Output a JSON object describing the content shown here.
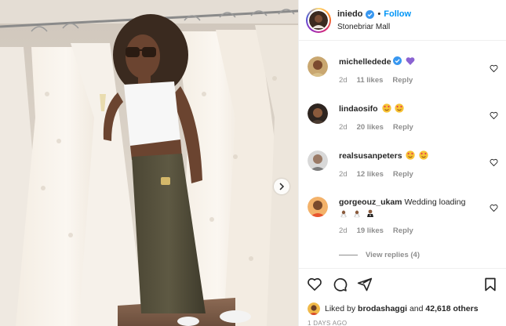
{
  "post": {
    "username": "iniedo",
    "follow_label": "Follow",
    "separator": "•",
    "location": "Stonebriar Mall"
  },
  "comments": [
    {
      "username": "michelledede",
      "verified": true,
      "text": "",
      "emojis": [
        "purple-heart-emoji"
      ],
      "age": "2d",
      "likes": "11 likes",
      "reply": "Reply"
    },
    {
      "username": "lindaosifo",
      "verified": false,
      "text": "",
      "emojis": [
        "heart-eyes-emoji",
        "heart-eyes-emoji"
      ],
      "age": "2d",
      "likes": "20 likes",
      "reply": "Reply"
    },
    {
      "username": "realsusanpeters",
      "verified": false,
      "text": "",
      "emojis": [
        "heart-eyes-emoji",
        "heart-eyes-emoji"
      ],
      "age": "2d",
      "likes": "12 likes",
      "reply": "Reply"
    },
    {
      "username": "gorgeouz_ukam",
      "verified": false,
      "text": "Wedding loading",
      "emojis": [
        "bride-emoji",
        "bride-emoji",
        "groom-emoji"
      ],
      "age": "2d",
      "likes": "19 likes",
      "reply": "Reply"
    }
  ],
  "view_replies": "View replies (4)",
  "likes": {
    "prefix": "Liked by",
    "user": "brodashaggi",
    "middle": "and",
    "count": "42,618 others"
  },
  "timestamp": "1 DAYS AGO",
  "icons": [
    "heart-icon",
    "comment-icon",
    "share-icon",
    "bookmark-icon",
    "verified-icon",
    "chevron-right-icon"
  ],
  "colors": {
    "accent": "#0095f6",
    "verified": "#3897f0",
    "text": "#262626",
    "muted": "#8e8e8e"
  }
}
